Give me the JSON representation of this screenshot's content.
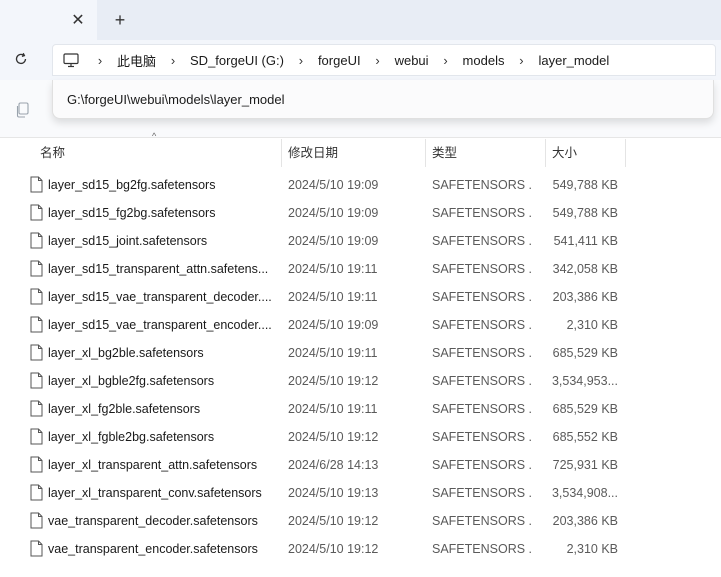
{
  "tabstrip": {
    "close_symbol": "✕",
    "add_symbol": "+"
  },
  "navbar": {
    "breadcrumbs": [
      "此电脑",
      "SD_forgeUI (G:)",
      "forgeUI",
      "webui",
      "models",
      "layer_model"
    ],
    "separator": "›",
    "icons": {
      "refresh": "refresh-icon",
      "computer": "computer-icon"
    }
  },
  "path_popup": {
    "value": "G:\\forgeUI\\webui\\models\\layer_model"
  },
  "columns": {
    "name": "名称",
    "date": "修改日期",
    "type": "类型",
    "size": "大小",
    "sort_indicator": "^"
  },
  "files": [
    {
      "name": "layer_sd15_bg2fg.safetensors",
      "date": "2024/5/10 19:09",
      "type": "SAFETENSORS ...",
      "size": "549,788 KB"
    },
    {
      "name": "layer_sd15_fg2bg.safetensors",
      "date": "2024/5/10 19:09",
      "type": "SAFETENSORS ...",
      "size": "549,788 KB"
    },
    {
      "name": "layer_sd15_joint.safetensors",
      "date": "2024/5/10 19:09",
      "type": "SAFETENSORS ...",
      "size": "541,411 KB"
    },
    {
      "name": "layer_sd15_transparent_attn.safetens...",
      "date": "2024/5/10 19:11",
      "type": "SAFETENSORS ...",
      "size": "342,058 KB"
    },
    {
      "name": "layer_sd15_vae_transparent_decoder....",
      "date": "2024/5/10 19:11",
      "type": "SAFETENSORS ...",
      "size": "203,386 KB"
    },
    {
      "name": "layer_sd15_vae_transparent_encoder....",
      "date": "2024/5/10 19:09",
      "type": "SAFETENSORS ...",
      "size": "2,310 KB"
    },
    {
      "name": "layer_xl_bg2ble.safetensors",
      "date": "2024/5/10 19:11",
      "type": "SAFETENSORS ...",
      "size": "685,529 KB"
    },
    {
      "name": "layer_xl_bgble2fg.safetensors",
      "date": "2024/5/10 19:12",
      "type": "SAFETENSORS ...",
      "size": "3,534,953..."
    },
    {
      "name": "layer_xl_fg2ble.safetensors",
      "date": "2024/5/10 19:11",
      "type": "SAFETENSORS ...",
      "size": "685,529 KB"
    },
    {
      "name": "layer_xl_fgble2bg.safetensors",
      "date": "2024/5/10 19:12",
      "type": "SAFETENSORS ...",
      "size": "685,552 KB"
    },
    {
      "name": "layer_xl_transparent_attn.safetensors",
      "date": "2024/6/28 14:13",
      "type": "SAFETENSORS ...",
      "size": "725,931 KB"
    },
    {
      "name": "layer_xl_transparent_conv.safetensors",
      "date": "2024/5/10 19:13",
      "type": "SAFETENSORS ...",
      "size": "3,534,908..."
    },
    {
      "name": "vae_transparent_decoder.safetensors",
      "date": "2024/5/10 19:12",
      "type": "SAFETENSORS ...",
      "size": "203,386 KB"
    },
    {
      "name": "vae_transparent_encoder.safetensors",
      "date": "2024/5/10 19:12",
      "type": "SAFETENSORS ...",
      "size": "2,310 KB"
    }
  ]
}
